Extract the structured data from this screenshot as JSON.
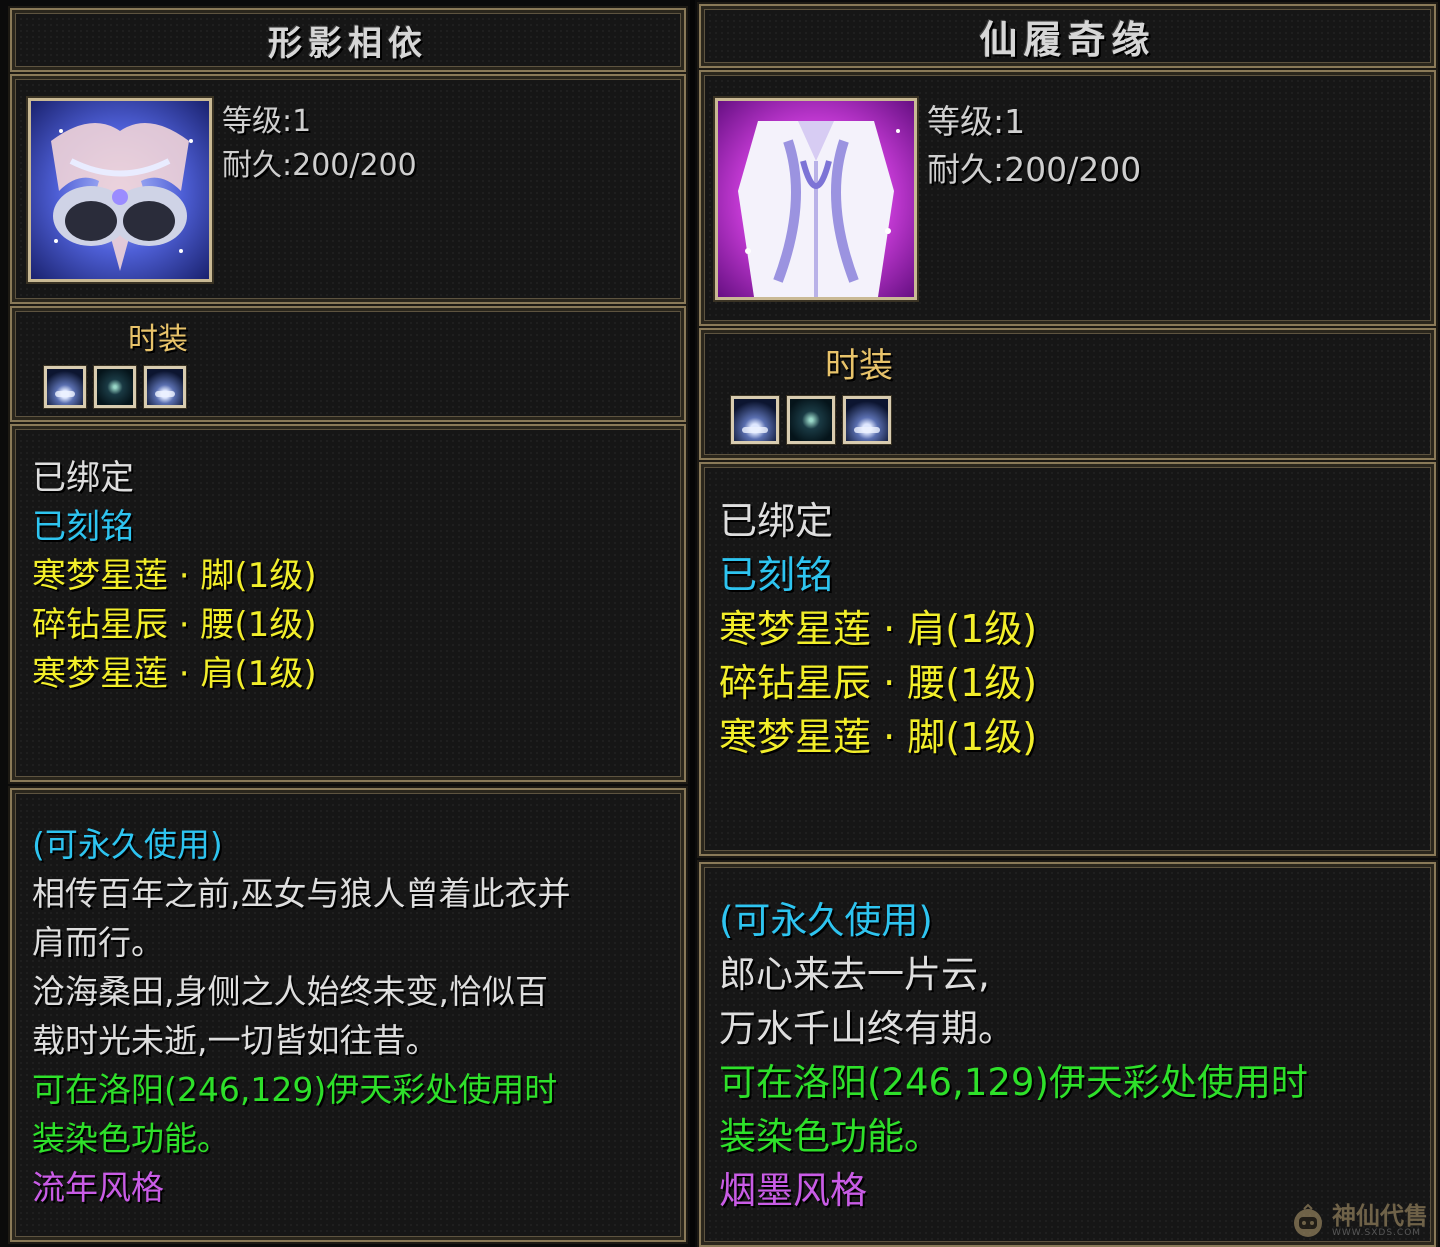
{
  "left": {
    "title": "形影相依",
    "level": "等级:1",
    "durability": "耐久:200/200",
    "category": "时装",
    "status": [
      "已绑定",
      "已刻铭"
    ],
    "sets": [
      "寒梦星莲 · 脚(1级)",
      "碎钻星辰 · 腰(1级)",
      "寒梦星莲 · 肩(1级)"
    ],
    "usage": "(可永久使用)",
    "desc": [
      "相传百年之前,巫女与狼人曾着此衣并",
      "肩而行。",
      "沧海桑田,身侧之人始终未变,恰似百",
      "载时光未逝,一切皆如往昔。"
    ],
    "dye": [
      "可在洛阳(246,129)伊天彩处使用时",
      "装染色功能。"
    ],
    "style": "流年风格"
  },
  "right": {
    "title": "仙履奇缘",
    "level": "等级:1",
    "durability": "耐久:200/200",
    "category": "时装",
    "status": [
      "已绑定",
      "已刻铭"
    ],
    "sets": [
      "寒梦星莲 · 肩(1级)",
      "碎钻星辰 · 腰(1级)",
      "寒梦星莲 · 脚(1级)"
    ],
    "usage": "(可永久使用)",
    "desc": [
      "郎心来去一片云,",
      "万水千山终有期。"
    ],
    "dye": [
      "可在洛阳(246,129)伊天彩处使用时",
      "装染色功能。"
    ],
    "style": "烟墨风格"
  },
  "watermark": {
    "text": "神仙代售",
    "sub": "WWW.SXDS.COM"
  }
}
